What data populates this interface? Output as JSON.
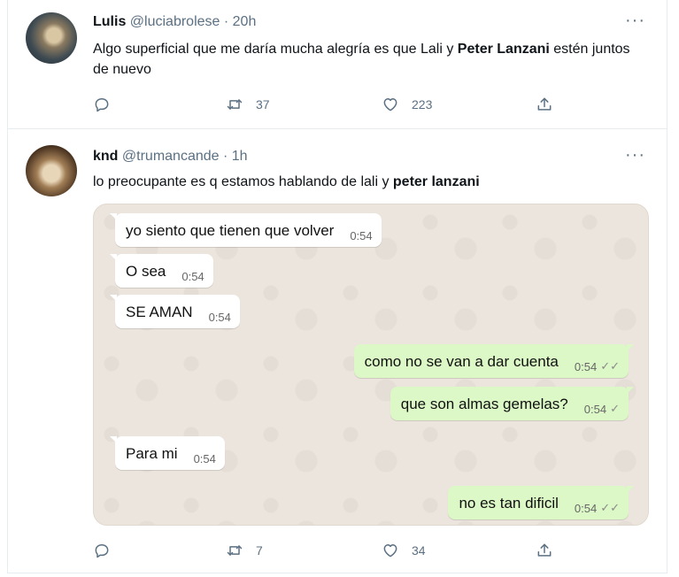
{
  "tweets": [
    {
      "name": "Lulis",
      "handle": "@luciabrolese",
      "sep": "·",
      "time": "20h",
      "text_before": "Algo superficial que me daría mucha alegría es que Lali y ",
      "text_bold": "Peter Lanzani",
      "text_after": " estén juntos de nuevo",
      "more": "···",
      "replies": "",
      "retweets": "37",
      "likes": "223"
    },
    {
      "name": "knd",
      "handle": "@trumancande",
      "sep": "·",
      "time": "1h",
      "text_before": "lo preocupante es q estamos hablando de lali y ",
      "text_bold": "peter lanzani",
      "text_after": "",
      "more": "···",
      "replies": "",
      "retweets": "7",
      "likes": "34"
    }
  ],
  "chat": {
    "messages": [
      {
        "dir": "in",
        "text": "yo siento que tienen que volver",
        "time": "0:54",
        "tick": ""
      },
      {
        "dir": "in",
        "text": "O sea",
        "time": "0:54",
        "tick": ""
      },
      {
        "dir": "in",
        "text": "SE AMAN",
        "time": "0:54",
        "tick": ""
      },
      {
        "dir": "out",
        "text": "como no se van a dar cuenta",
        "time": "0:54",
        "tick": "✓✓"
      },
      {
        "dir": "out",
        "text": "que son almas gemelas?",
        "time": "0:54",
        "tick": "✓"
      },
      {
        "dir": "in",
        "text": "Para mi",
        "time": "0:54",
        "tick": ""
      },
      {
        "dir": "out",
        "text": "no es tan dificil",
        "time": "0:54",
        "tick": "✓✓"
      }
    ]
  },
  "icons": {
    "reply": "reply-icon",
    "retweet": "retweet-icon",
    "like": "heart-icon",
    "share": "share-icon",
    "more": "more-icon"
  },
  "colors": {
    "secondary_text": "#5b7083",
    "chat_background": "#ece5dd",
    "outgoing_bubble": "#dcf8c6",
    "incoming_bubble": "#ffffff"
  }
}
